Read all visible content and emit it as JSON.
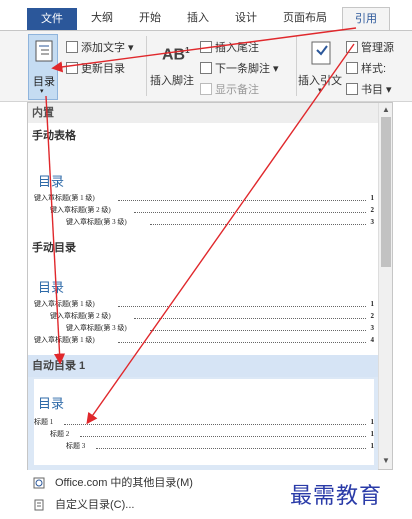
{
  "ribbon_tabs": [
    {
      "label": "文件"
    },
    {
      "label": "大纲"
    },
    {
      "label": "开始"
    },
    {
      "label": "插入"
    },
    {
      "label": "设计"
    },
    {
      "label": "页面布局"
    },
    {
      "label": "引用"
    }
  ],
  "ribbon": {
    "toc_label": "目录",
    "add_text": "添加文字",
    "update_toc": "更新目录",
    "insert_footnote": "插入脚注",
    "insert_endnote": "插入尾注",
    "next_footnote": "下一条脚注",
    "show_notes": "显示备注",
    "insert_citation": "插入引文",
    "manage_sources": "管理源",
    "style": "样式:",
    "bibliography": "书目",
    "ab_glyph": "AB",
    "ab_sup": "1"
  },
  "panel": {
    "builtin_header": "内置",
    "manual_table": {
      "label": "手动表格",
      "preview_title": "目录",
      "lines": [
        {
          "text": "键入章标题(第 1 级)",
          "page": "1"
        },
        {
          "text": "键入章标题(第 2 级)",
          "page": "2"
        },
        {
          "text": "键入章标题(第 3 级)",
          "page": "3"
        }
      ]
    },
    "manual_toc": {
      "label": "手动目录",
      "preview_title": "目录",
      "lines": [
        {
          "text": "键入章标题(第 1 级)",
          "page": "1"
        },
        {
          "text": "键入章标题(第 2 级)",
          "page": "2"
        },
        {
          "text": "键入章标题(第 3 级)",
          "page": "3"
        },
        {
          "text": "键入章标题(第 1 级)",
          "page": "4"
        }
      ]
    },
    "auto_toc_1": {
      "label": "自动目录 1",
      "preview_title": "目录",
      "lines": [
        {
          "text": "标题 1",
          "page": "1"
        },
        {
          "text": "标题 2",
          "page": "1"
        },
        {
          "text": "标题 3",
          "page": "1"
        }
      ]
    }
  },
  "menu": {
    "more_tocs": "Office.com 中的其他目录(M)",
    "custom_toc": "自定义目录(C)..."
  },
  "watermark": "最需教育",
  "colors": {
    "accent": "#2b579a",
    "arrow": "#e0282c",
    "toc_title": "#2e6aa8",
    "watermark": "#2a3ba8"
  }
}
